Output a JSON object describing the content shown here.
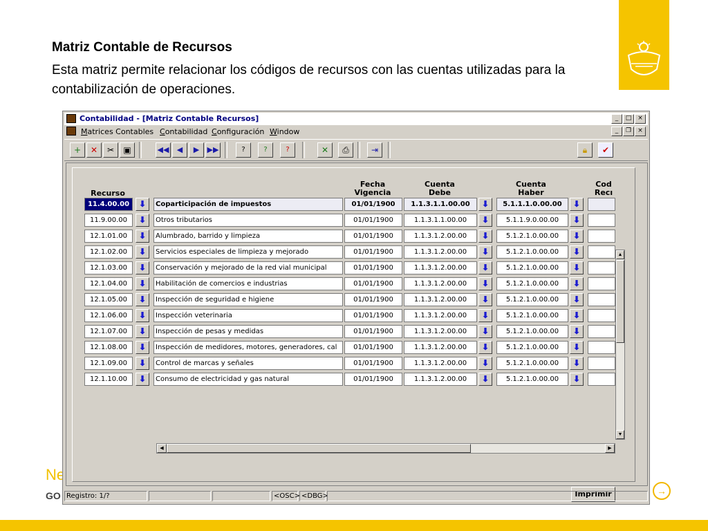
{
  "slide": {
    "title": "Matriz Contable de Recursos",
    "description": "Esta matriz permite relacionar los códigos de recursos con las cuentas utilizadas para la contabilización de operaciones.",
    "partial_text_1": "Ne",
    "partial_text_2": "GO",
    "accent_color": "#f5c400"
  },
  "window": {
    "title": "Contabilidad - [Matriz Contable Recursos]",
    "controls_outer": [
      "_",
      "□",
      "×"
    ],
    "controls_inner": [
      "_",
      "❐",
      "×"
    ]
  },
  "menu": {
    "items": [
      {
        "label": "Matrices Contables",
        "underline": "M",
        "rest": "atrices Contables"
      },
      {
        "label": "Contabilidad",
        "underline": "C",
        "rest": "ontabilidad"
      },
      {
        "label": "Configuración",
        "underline": "C",
        "rest": "onfiguración"
      },
      {
        "label": "Window",
        "underline": "W",
        "rest": "indow"
      }
    ]
  },
  "toolbar": {
    "icons": [
      "insert-record-icon",
      "delete-record-icon",
      "cut-icon",
      "save-icon",
      "first-record-icon",
      "previous-record-icon",
      "next-record-icon",
      "last-record-icon",
      "query-icon",
      "execute-query-icon",
      "cancel-query-icon",
      "excel-icon",
      "print-icon",
      "exit-icon",
      "lock-icon",
      "check-icon"
    ]
  },
  "table": {
    "headers": {
      "recurso": "Recurso",
      "fecha": "Fecha\nVigencia",
      "debe": "Cuenta\nDebe",
      "haber": "Cuenta\nHaber",
      "cod": "Cod\nRecı"
    },
    "rows": [
      {
        "code": "11.4.00.00",
        "desc": "Coparticipación de impuestos",
        "date": "01/01/1900",
        "debe": "1.1.3.1.1.00.00",
        "haber": "5.1.1.1.0.00.00"
      },
      {
        "code": "11.9.00.00",
        "desc": "Otros tributarios",
        "date": "01/01/1900",
        "debe": "1.1.3.1.1.00.00",
        "haber": "5.1.1.9.0.00.00"
      },
      {
        "code": "12.1.01.00",
        "desc": "Alumbrado, barrido y limpieza",
        "date": "01/01/1900",
        "debe": "1.1.3.1.2.00.00",
        "haber": "5.1.2.1.0.00.00"
      },
      {
        "code": "12.1.02.00",
        "desc": "Servicios especiales de limpieza y mejorado",
        "date": "01/01/1900",
        "debe": "1.1.3.1.2.00.00",
        "haber": "5.1.2.1.0.00.00"
      },
      {
        "code": "12.1.03.00",
        "desc": "Conservación y mejorado de la red vial municipal",
        "date": "01/01/1900",
        "debe": "1.1.3.1.2.00.00",
        "haber": "5.1.2.1.0.00.00"
      },
      {
        "code": "12.1.04.00",
        "desc": "Habilitación de comercios e industrias",
        "date": "01/01/1900",
        "debe": "1.1.3.1.2.00.00",
        "haber": "5.1.2.1.0.00.00"
      },
      {
        "code": "12.1.05.00",
        "desc": "Inspección de seguridad e higiene",
        "date": "01/01/1900",
        "debe": "1.1.3.1.2.00.00",
        "haber": "5.1.2.1.0.00.00"
      },
      {
        "code": "12.1.06.00",
        "desc": "Inspección veterinaria",
        "date": "01/01/1900",
        "debe": "1.1.3.1.2.00.00",
        "haber": "5.1.2.1.0.00.00"
      },
      {
        "code": "12.1.07.00",
        "desc": "Inspección de pesas y medidas",
        "date": "01/01/1900",
        "debe": "1.1.3.1.2.00.00",
        "haber": "5.1.2.1.0.00.00"
      },
      {
        "code": "12.1.08.00",
        "desc": "Inspección de medidores, motores, generadores, cal",
        "date": "01/01/1900",
        "debe": "1.1.3.1.2.00.00",
        "haber": "5.1.2.1.0.00.00"
      },
      {
        "code": "12.1.09.00",
        "desc": "Control de marcas y señales",
        "date": "01/01/1900",
        "debe": "1.1.3.1.2.00.00",
        "haber": "5.1.2.1.0.00.00"
      },
      {
        "code": "12.1.10.00",
        "desc": "Consumo de electricidad y gas natural",
        "date": "01/01/1900",
        "debe": "1.1.3.1.2.00.00",
        "haber": "5.1.2.1.0.00.00"
      }
    ]
  },
  "buttons": {
    "print": "Imprimir"
  },
  "statusbar": {
    "record": "Registro: 1/?",
    "osc": "<OSC>",
    "dbg": "<DBG>"
  }
}
